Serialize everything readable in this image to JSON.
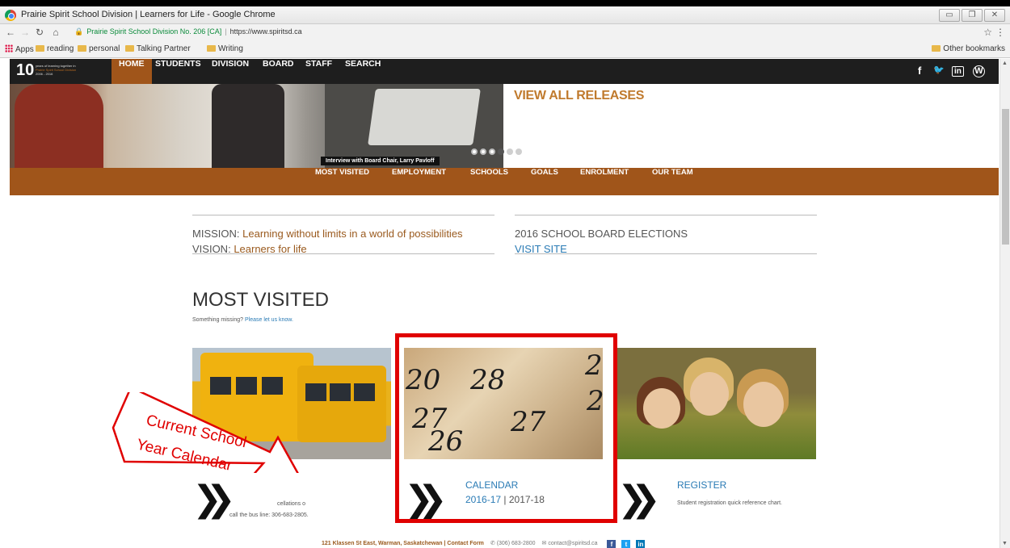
{
  "browser": {
    "window_title": "Prairie Spirit School Division | Learners for Life - Google Chrome",
    "site_label": "Prairie Spirit School Division No. 206 [CA]",
    "url": "https://www.spiritsd.ca",
    "bookmarks": [
      {
        "label": "Apps",
        "icon": "apps-icon"
      },
      {
        "label": "reading",
        "icon": "folder-icon"
      },
      {
        "label": "personal",
        "icon": "folder-icon"
      },
      {
        "label": "Talking Partner",
        "icon": "folder-icon"
      },
      {
        "label": "Writing",
        "icon": "folder-icon"
      }
    ],
    "other_bookmarks": "Other bookmarks"
  },
  "site_nav": {
    "logo_number": "10",
    "logo_line1": "years of learning together in",
    "logo_line2": "Prairie Spirit School Division",
    "logo_line3": "2006 - 2016",
    "items": [
      "HOME",
      "STUDENTS",
      "DIVISION",
      "BOARD",
      "STAFF",
      "SEARCH"
    ],
    "active_item": "HOME",
    "social": [
      "facebook-icon",
      "twitter-icon",
      "linkedin-icon",
      "wordpress-icon"
    ],
    "social_glyphs": [
      "f",
      "🐦",
      "in",
      "W"
    ]
  },
  "hero": {
    "caption": "Interview with Board Chair, Larry Pavloff",
    "releases_link": "VIEW ALL RELEASES"
  },
  "sub_nav": {
    "items": [
      "MOST VISITED",
      "EMPLOYMENT",
      "SCHOOLS",
      "GOALS",
      "ENROLMENT",
      "OUR TEAM"
    ]
  },
  "mission": {
    "mission_label": "MISSION:",
    "mission_text": "Learning without limits in a world of possibilities",
    "vision_label": "VISION:",
    "vision_text": "Learners for life"
  },
  "elections": {
    "title": "2016 SCHOOL BOARD ELECTIONS",
    "link": "VISIT SITE"
  },
  "most_visited": {
    "title": "MOST VISITED",
    "subtitle": "Something missing?",
    "subtitle_link": "Please let us know.",
    "cards": [
      {
        "desc_line1": "cellations o",
        "desc_line2": "call the bus",
        "desc_line3": "line: 306-683-2805."
      },
      {
        "title": "CALENDAR",
        "link1": "2016-17",
        "separator": " | ",
        "link2": "2017-18"
      },
      {
        "title": "REGISTER",
        "desc": "Student registration quick reference chart."
      }
    ]
  },
  "calendar_numbers": [
    "20",
    "28",
    "27",
    "27",
    "26",
    "2",
    "2"
  ],
  "annotation": {
    "line1": "Current School",
    "line2": "Year Calendar",
    "color": "#e00000"
  },
  "footer": {
    "address": "121 Klassen St East, Warman, Saskatchewan",
    "separator": " | ",
    "contact": "Contact Form",
    "phone": "(306) 683-2800",
    "email": "contact@spiritsd.ca"
  },
  "colors": {
    "brand_brown": "#a0551a",
    "link_blue": "#2a7bb5",
    "nav_dark": "#1e1e1e"
  }
}
